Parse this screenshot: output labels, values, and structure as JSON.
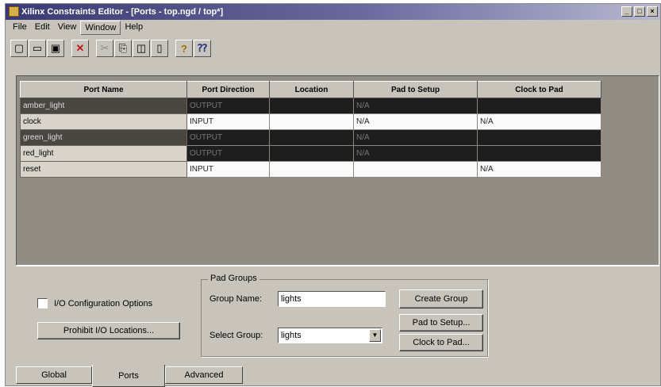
{
  "window": {
    "title": "Xilinx Constraints Editor - [Ports - top.ngd / top*]",
    "controls": [
      "_",
      "□",
      "×"
    ]
  },
  "menu": [
    "File",
    "Edit",
    "View",
    "Window",
    "Help"
  ],
  "toolbar": [
    {
      "icon": "new-icon",
      "glyph": "▢"
    },
    {
      "icon": "open-icon",
      "glyph": "▭"
    },
    {
      "icon": "save-icon",
      "glyph": "▣"
    },
    {
      "icon": "delete-icon",
      "glyph": "✕"
    },
    {
      "icon": "cut-icon",
      "glyph": "✂"
    },
    {
      "icon": "copy-icon",
      "glyph": "⎘"
    },
    {
      "icon": "paste-icon",
      "glyph": "◫"
    },
    {
      "icon": "property-icon",
      "glyph": "▯"
    },
    {
      "icon": "help-icon",
      "glyph": "?"
    },
    {
      "icon": "context-help-icon",
      "glyph": "⁇"
    }
  ],
  "table": {
    "columns": [
      "Port Name",
      "Port Direction",
      "Location",
      "Pad to Setup",
      "Clock to Pad"
    ],
    "rows": [
      {
        "name": "amber_light",
        "direction": "OUTPUT",
        "location": "",
        "pad_to_setup": "N/A",
        "clock_to_pad": ""
      },
      {
        "name": "clock",
        "direction": "INPUT",
        "location": "",
        "pad_to_setup": "N/A",
        "clock_to_pad": "N/A"
      },
      {
        "name": "green_light",
        "direction": "OUTPUT",
        "location": "",
        "pad_to_setup": "N/A",
        "clock_to_pad": ""
      },
      {
        "name": "red_light",
        "direction": "OUTPUT",
        "location": "",
        "pad_to_setup": "N/A",
        "clock_to_pad": ""
      },
      {
        "name": "reset",
        "direction": "INPUT",
        "location": "",
        "pad_to_setup": "",
        "clock_to_pad": "N/A"
      }
    ]
  },
  "options": {
    "io_config_label": "I/O Configuration Options",
    "prohibit_button": "Prohibit I/O Locations..."
  },
  "pad_groups": {
    "title": "Pad Groups",
    "group_name_label": "Group Name:",
    "group_name_value": "lights",
    "select_group_label": "Select Group:",
    "select_group_value": "lights",
    "create_button": "Create Group",
    "pad_to_setup_button": "Pad to Setup...",
    "clock_to_pad_button": "Clock to Pad..."
  },
  "tabs": [
    "Global",
    "Ports",
    "Advanced"
  ]
}
